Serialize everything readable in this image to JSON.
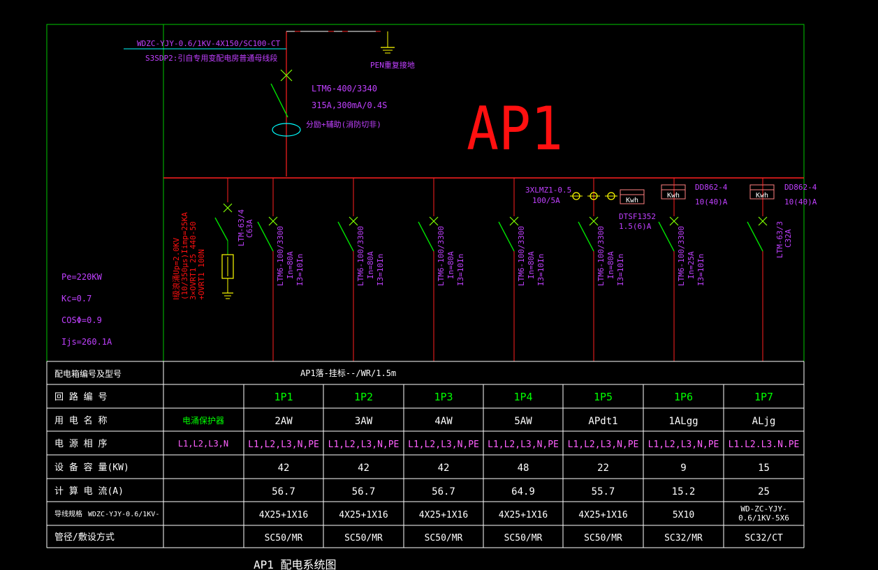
{
  "colors": {
    "background": "#000000",
    "frame": "#00c800",
    "busbar": "#ff2020",
    "breaker": "#00e000",
    "breaker_x": "#80ff00",
    "label": "#c040ff",
    "incoming": "#00ffff",
    "title_big": "#ff1010",
    "yellow": "#ffff00",
    "table_text": "#ffffff",
    "green_text": "#00ff00",
    "mag_text": "#ff60ff",
    "cyan_text": "#00ffff"
  },
  "header": {
    "incoming_cable": "WDZC-YJY-0.6/1KV-4X150/SC100-CT",
    "incoming_source": "S3SDP2:引自专用变配电房普通母线段",
    "pen": "PEN重复接地",
    "main_breaker": "LTM6-400/3340",
    "main_rating": "315A,300mA/0.4S",
    "main_function": "分励+辅助(消防切非)",
    "panel_name": "AP1"
  },
  "params": {
    "pe": "Pe=220KW",
    "kc": "Kc=0.7",
    "cos": "COSΦ=0.9",
    "ijs": "Ijs=260.1A"
  },
  "spd": {
    "breaker": "LTM-63/4",
    "breaker_rating": "C63A",
    "line1": "Ⅰ级浪涌Up=2.0KV",
    "line2": "(10/350μs)Iimp=25KA",
    "line3": "3×OVRT1 25 440-50",
    "line4": "+OVRT1 100N"
  },
  "meters": {
    "ct": "3XLMZ1-0.5",
    "ct_ratio": "100/5A",
    "kwh": "Kwh",
    "dtsf": "DTSF1352",
    "dtsf_rating": "1.5(6)A",
    "dd1": "DD862-4",
    "dd1_rating": "10(40)A",
    "dd2": "DD862-4",
    "dd2_rating": "10(40)A"
  },
  "feeders": [
    {
      "model": "LTM6-100/3300",
      "in": "In=80A",
      "ib": "I3=10In"
    },
    {
      "model": "LTM6-100/3300",
      "in": "In=80A",
      "ib": "I3=10In"
    },
    {
      "model": "LTM6-100/3300",
      "in": "In=80A",
      "ib": "I3=10In"
    },
    {
      "model": "LTM6-100/3300",
      "in": "In=80A",
      "ib": "I3=10In"
    },
    {
      "model": "LTM6-100/3300",
      "in": "In=80A",
      "ib": "I3=10In"
    },
    {
      "model": "LTM6-100/3300",
      "in": "In=25A",
      "ib": "I3=10In"
    },
    {
      "model": "LTM-63/3",
      "in": "C32A",
      "ib": ""
    }
  ],
  "table": {
    "panel_label": "配电箱编号及型号",
    "panel_value": "AP1落-挂标--/WR/1.5m",
    "row_labels": [
      "回 路 编 号",
      "用 电 名 称",
      "电 源 相 序",
      "设 备 容 量(KW)",
      "计 算 电 流(A)",
      "导线规格",
      "管径/敷设方式"
    ],
    "cable_prefix": "WDZC-YJY-0.6/1KV-",
    "spd_column": {
      "name": "电涌保护器",
      "phase": "L1,L2,L3,N"
    },
    "circuits": [
      {
        "id": "1P1",
        "name": "2AW",
        "phase": "L1,L2,L3,N,PE",
        "kw": "42",
        "amps": "56.7",
        "cable": "4X25+1X16",
        "pipe": "SC50/MR"
      },
      {
        "id": "1P2",
        "name": "3AW",
        "phase": "L1,L2,L3,N,PE",
        "kw": "42",
        "amps": "56.7",
        "cable": "4X25+1X16",
        "pipe": "SC50/MR"
      },
      {
        "id": "1P3",
        "name": "4AW",
        "phase": "L1,L2,L3,N,PE",
        "kw": "42",
        "amps": "56.7",
        "cable": "4X25+1X16",
        "pipe": "SC50/MR"
      },
      {
        "id": "1P4",
        "name": "5AW",
        "phase": "L1,L2,L3,N,PE",
        "kw": "48",
        "amps": "64.9",
        "cable": "4X25+1X16",
        "pipe": "SC50/MR"
      },
      {
        "id": "1P5",
        "name": "APdt1",
        "phase": "L1,L2,L3,N,PE",
        "kw": "22",
        "amps": "55.7",
        "cable": "4X25+1X16",
        "pipe": "SC50/MR"
      },
      {
        "id": "1P6",
        "name": "1ALgg",
        "phase": "L1,L2,L3,N,PE",
        "kw": "9",
        "amps": "15.2",
        "cable": "5X10",
        "pipe": "SC32/MR"
      },
      {
        "id": "1P7",
        "name": "ALjg",
        "phase": "L1.L2.L3.N.PE",
        "kw": "15",
        "amps": "25",
        "cable": "WD-ZC-YJY-0.6/1KV-5X6",
        "pipe": "SC32/CT"
      }
    ]
  },
  "footer_title": "AP1  配电系统图"
}
